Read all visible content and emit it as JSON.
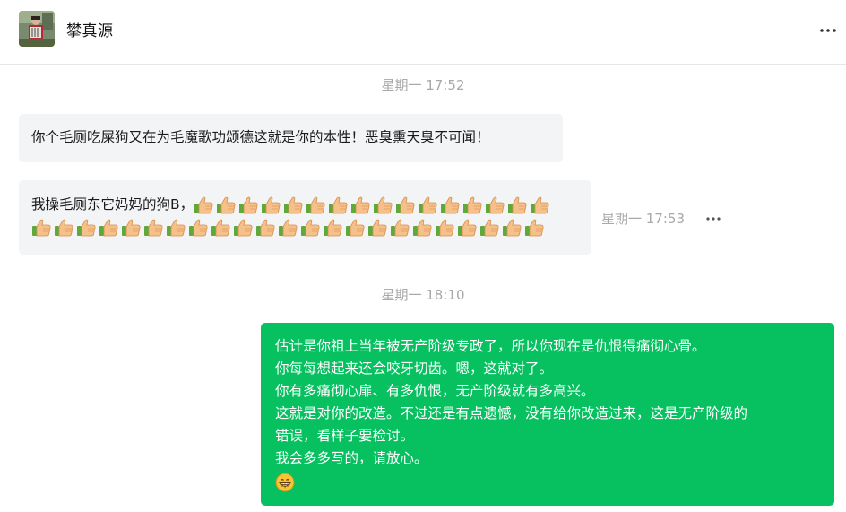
{
  "header": {
    "contact_name": "攀真源",
    "avatar_icon": "accordion-player-photo",
    "more_icon": "ellipsis-icon"
  },
  "messages": {
    "time1": "星期一 17:52",
    "msg1": "你个毛厕吃屎狗又在为毛魔歌功颂德这就是你的本性！恶臭熏天臭不可闻！",
    "msg2_text": "我操毛厕东它妈妈的狗B，",
    "msg2_emoji": "thumbs-up",
    "msg2_emoji_count_row1": 16,
    "msg2_emoji_count_row2": 23,
    "msg2_time": "星期一 17:53",
    "time3": "星期一 18:10",
    "msg3_lines": [
      "估计是你祖上当年被无产阶级专政了，所以你现在是仇恨得痛彻心骨。",
      "你每每想起来还会咬牙切齿。嗯，这就对了。",
      "你有多痛彻心扉、有多仇恨，无产阶级就有多高兴。",
      "这就是对你的改造。不过还是有点遗憾，没有给你改造过来，这是无产阶级的",
      "错误，看样子要检讨。",
      "我会多多写的，请放心。"
    ],
    "msg3_emoji": "grin-emoji"
  },
  "colors": {
    "incoming_bubble": "#f3f4f6",
    "outgoing_bubble": "#07c160",
    "timestamp": "#a8a8a8"
  }
}
